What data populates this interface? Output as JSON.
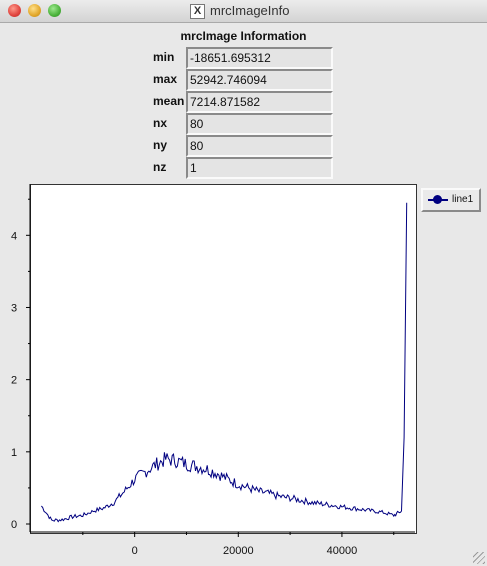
{
  "window": {
    "title": "mrcImageInfo"
  },
  "info": {
    "heading": "mrcImage Information",
    "fields": [
      {
        "label": "min",
        "value": "-18651.695312"
      },
      {
        "label": "max",
        "value": "52942.746094"
      },
      {
        "label": "mean",
        "value": "7214.871582"
      },
      {
        "label": "nx",
        "value": "80"
      },
      {
        "label": "ny",
        "value": "80"
      },
      {
        "label": "nz",
        "value": "1"
      }
    ]
  },
  "chart_data": {
    "type": "line",
    "title": "",
    "xlabel": "",
    "ylabel": "",
    "xlim": [
      -18651.695312,
      52942.746094
    ],
    "ylim": [
      0,
      4.6
    ],
    "x_ticks": [
      0,
      20000,
      40000
    ],
    "y_ticks": [
      0,
      1,
      2,
      3,
      4
    ],
    "legend": "top-right",
    "grid": false,
    "series": [
      {
        "name": "line1",
        "color": "#000080",
        "x": [
          -18000,
          -16000,
          -14000,
          -12000,
          -10000,
          -8000,
          -6000,
          -4000,
          -2000,
          0,
          2000,
          4000,
          6000,
          8000,
          10000,
          12000,
          14000,
          16000,
          18000,
          20000,
          22000,
          24000,
          26000,
          28000,
          30000,
          32000,
          34000,
          36000,
          38000,
          40000,
          42000,
          44000,
          46000,
          48000,
          50000,
          51500,
          52000,
          52500
        ],
        "y": [
          0.25,
          0.05,
          0.06,
          0.1,
          0.12,
          0.18,
          0.22,
          0.3,
          0.45,
          0.62,
          0.72,
          0.82,
          0.9,
          0.88,
          0.83,
          0.8,
          0.76,
          0.7,
          0.62,
          0.55,
          0.5,
          0.45,
          0.42,
          0.38,
          0.36,
          0.33,
          0.3,
          0.28,
          0.26,
          0.24,
          0.22,
          0.2,
          0.18,
          0.16,
          0.12,
          0.18,
          1.2,
          4.45
        ]
      }
    ]
  }
}
